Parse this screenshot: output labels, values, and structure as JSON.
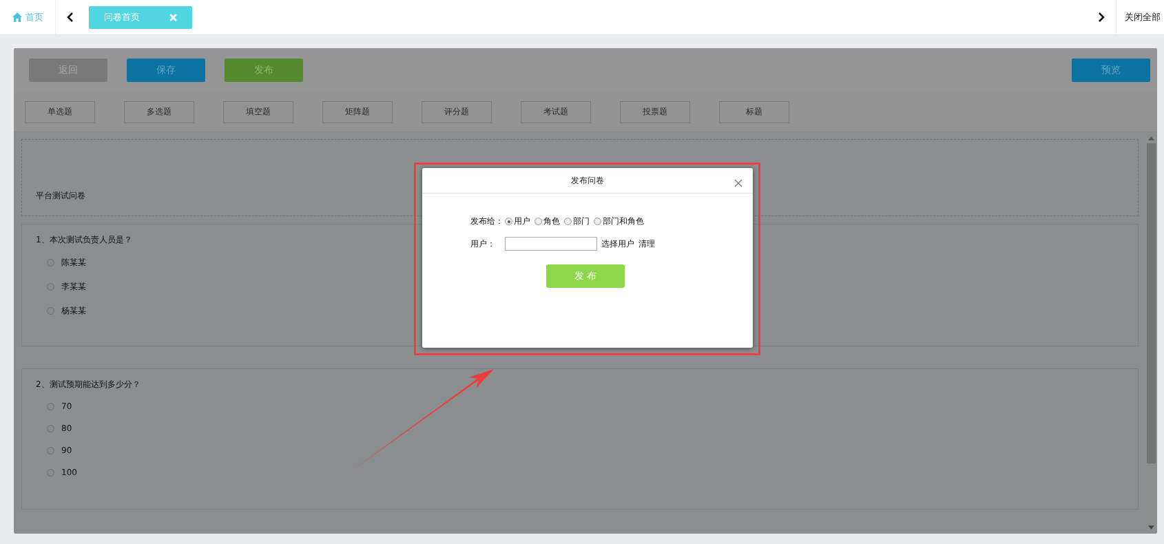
{
  "tab_bar": {
    "home": "首页",
    "tabs": [
      {
        "label": "问卷首页",
        "selected": true
      }
    ],
    "close_all": "关闭全部"
  },
  "toolbar": {
    "buttons": [
      {
        "label": "返回",
        "kind": "back"
      },
      {
        "label": "保存",
        "kind": "save"
      },
      {
        "label": "发布",
        "kind": "publish"
      }
    ],
    "preview": "预览"
  },
  "question_types": [
    "单选题",
    "多选题",
    "填空题",
    "矩阵题",
    "评分题",
    "考试题",
    "投票题",
    "标题"
  ],
  "survey": {
    "subtitle": "平台测试问卷",
    "questions": [
      {
        "title": "1、本次测试负责人员是？",
        "options": [
          {
            "label": "陈某某",
            "selected": false
          },
          {
            "label": "李某某",
            "selected": false
          },
          {
            "label": "杨某某",
            "selected": false
          }
        ]
      },
      {
        "title": "2、测试预期能达到多少分？",
        "options": [
          {
            "label": "70",
            "selected": false
          },
          {
            "label": "80",
            "selected": false
          },
          {
            "label": "90",
            "selected": false
          },
          {
            "label": "100",
            "selected": false
          }
        ]
      }
    ]
  },
  "dialog": {
    "title": "发布问卷",
    "publish_to_label": "发布给：",
    "targets": [
      {
        "label": "用户",
        "selected": true
      },
      {
        "label": "角色",
        "selected": false
      },
      {
        "label": "部门",
        "selected": false
      },
      {
        "label": "部门和角色",
        "selected": false
      }
    ],
    "user_label": "用户：",
    "links": [
      "选择用户",
      "清理"
    ],
    "submit": "发 布"
  }
}
